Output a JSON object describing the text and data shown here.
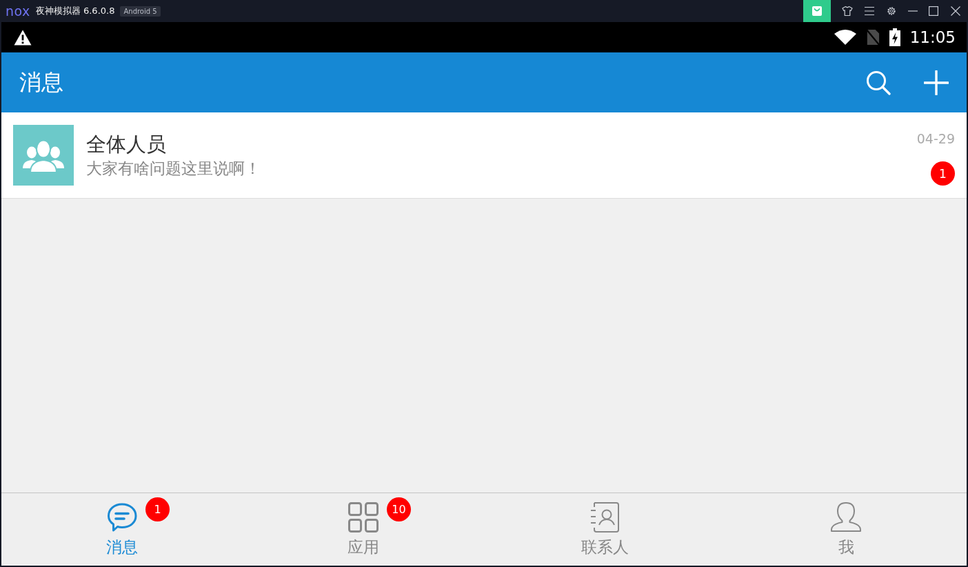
{
  "window": {
    "logo": "nox",
    "title": "夜神模拟器 6.6.0.8",
    "badge": "Android 5"
  },
  "status_bar": {
    "time": "11:05"
  },
  "app_bar": {
    "title": "消息"
  },
  "conversations": [
    {
      "name": "全体人员",
      "preview": "大家有啥问题这里说啊！",
      "time": "04-29",
      "unread": "1"
    }
  ],
  "tabs": [
    {
      "kind": "chat",
      "label": "消息",
      "selected": true,
      "badge": "1"
    },
    {
      "kind": "apps",
      "label": "应用",
      "selected": false,
      "badge": "10"
    },
    {
      "kind": "contacts",
      "label": "联系人",
      "selected": false
    },
    {
      "kind": "me",
      "label": "我",
      "selected": false
    }
  ]
}
